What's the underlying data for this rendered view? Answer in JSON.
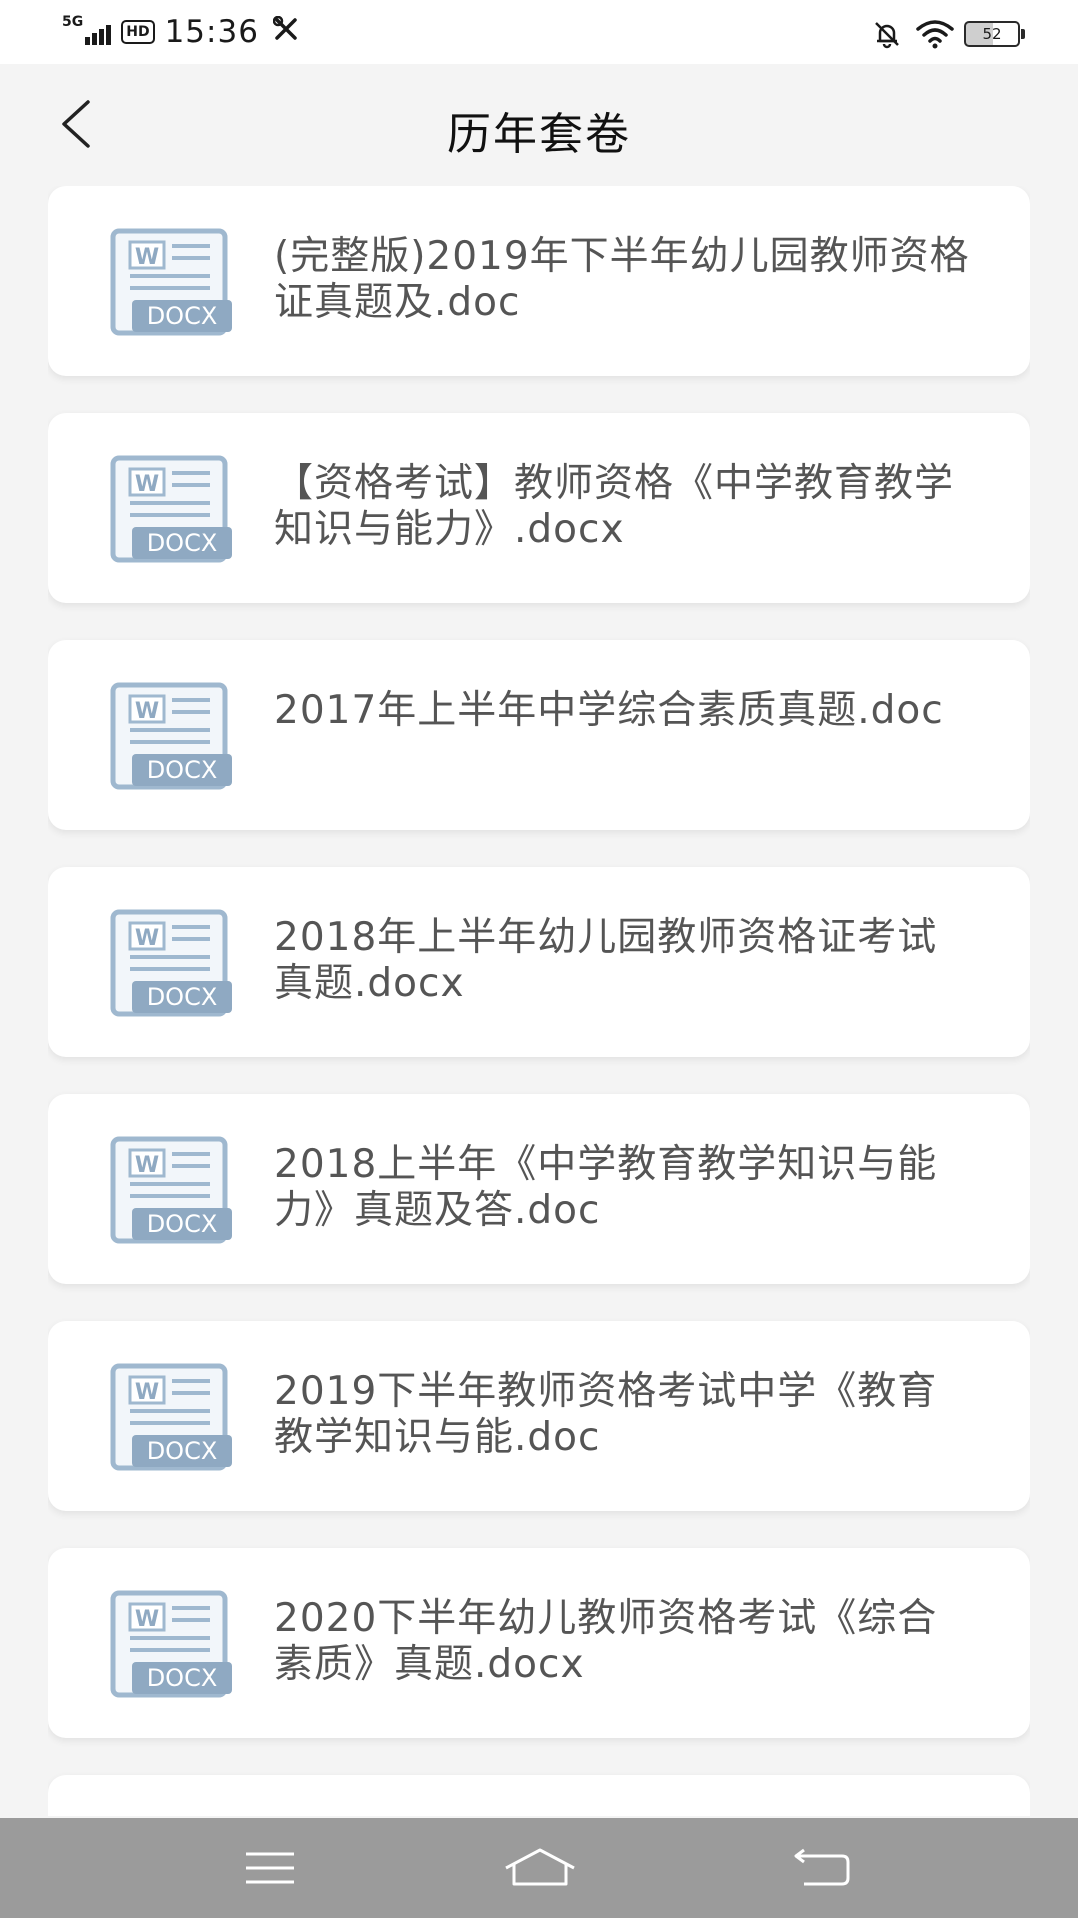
{
  "status_bar": {
    "network": "5G",
    "hd": "HD",
    "time": "15:36",
    "tools_icon": "wrench-screwdriver-icon",
    "battery": "52"
  },
  "header": {
    "title": "历年套卷",
    "back_icon": "chevron-left-icon"
  },
  "list": {
    "icon_badge": "DOCX",
    "icon_letter": "W",
    "items": [
      {
        "title": "(完整版)2019年下半年幼儿园教师资格证真题及.doc"
      },
      {
        "title": "【资格考试】教师资格《中学教育教学知识与能力》.docx"
      },
      {
        "title": "2017年上半年中学综合素质真题.doc"
      },
      {
        "title": "2018年上半年幼儿园教师资格证考试真题.docx"
      },
      {
        "title": "2018上半年《中学教育教学知识与能力》真题及答.doc"
      },
      {
        "title": "2019下半年教师资格考试中学《教育教学知识与能.doc"
      },
      {
        "title": "2020下半年幼儿教师资格考试《综合素质》真题.docx"
      },
      {
        "title": ""
      }
    ]
  },
  "nav_bar": {
    "menu_icon": "menu-icon",
    "home_icon": "home-icon",
    "back_icon": "back-arrow-icon"
  }
}
